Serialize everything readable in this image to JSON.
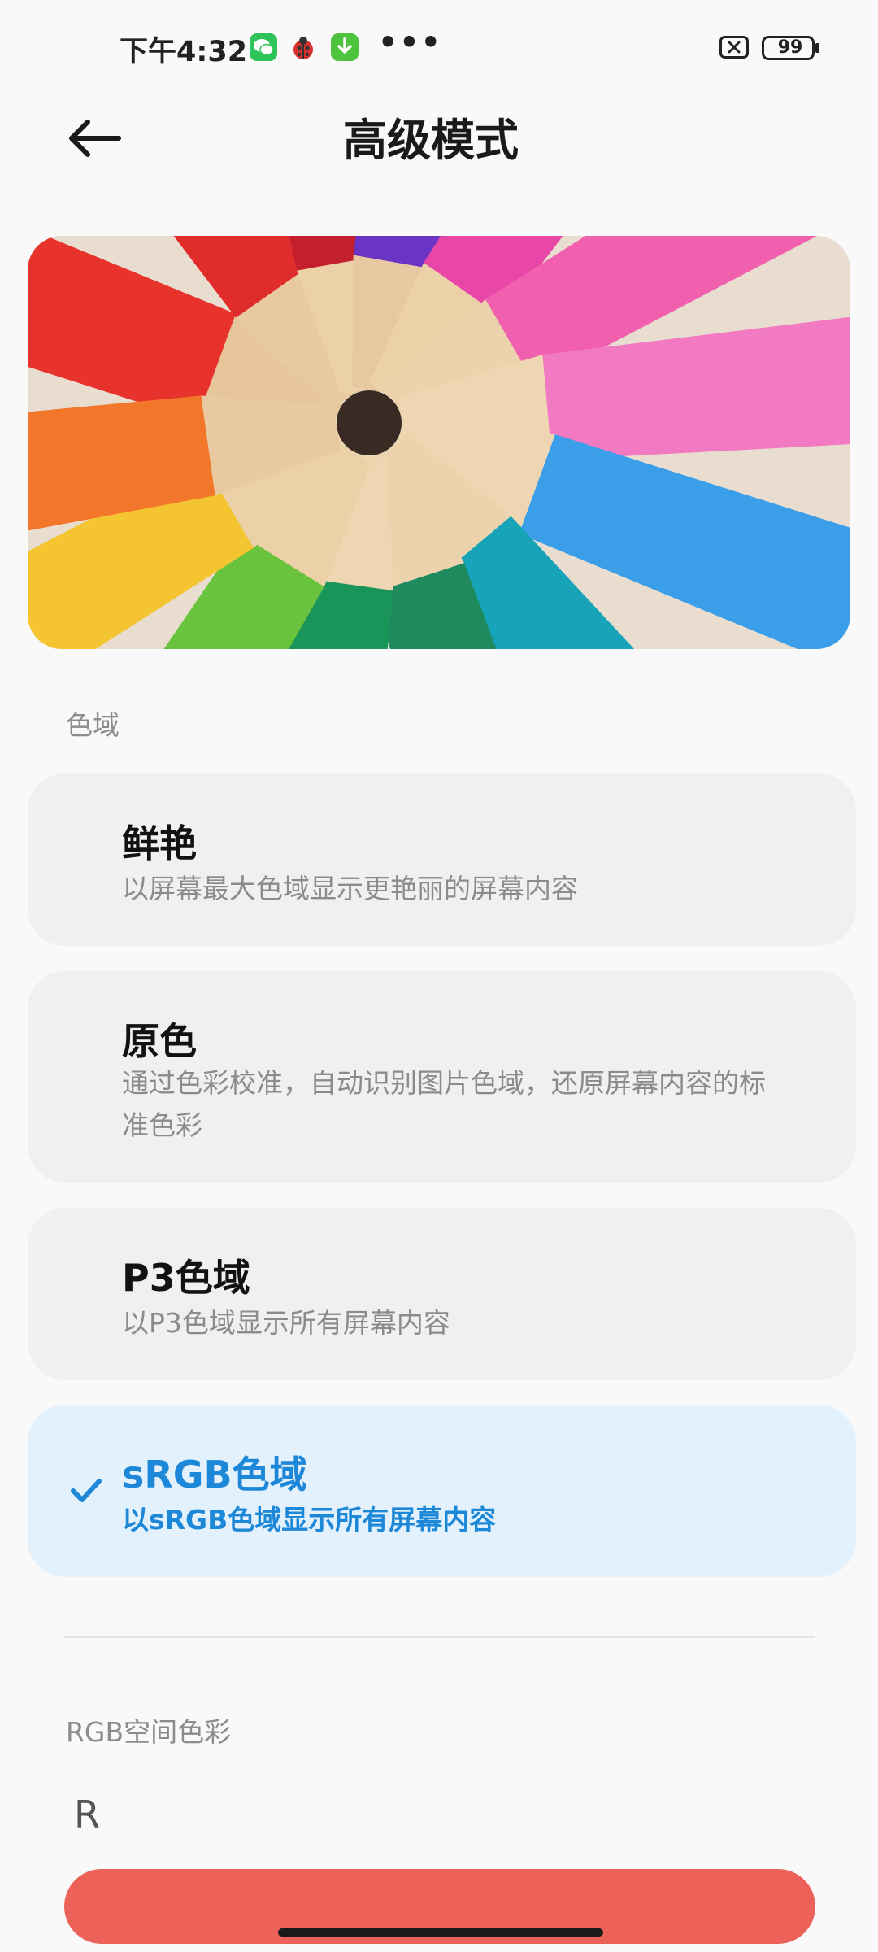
{
  "status_bar": {
    "time": "下午4:32",
    "more": "•••",
    "battery": "99",
    "app_icons": [
      "wechat-icon",
      "ladybug-icon",
      "download-icon"
    ]
  },
  "header": {
    "title": "高级模式",
    "back_icon": "arrow-left-icon"
  },
  "gamut": {
    "label": "色域",
    "selected": "sRGB色域",
    "options": [
      {
        "title": "鲜艳",
        "desc": "以屏幕最大色域显示更艳丽的屏幕内容",
        "selected": false
      },
      {
        "title": "原色",
        "desc": "通过色彩校准，自动识别图片色域，还原屏幕内容的标准色彩",
        "selected": false
      },
      {
        "title": "P3色域",
        "desc": "以P3色域显示所有屏幕内容",
        "selected": false
      },
      {
        "title": "sRGB色域",
        "desc": "以sRGB色域显示所有屏幕内容",
        "selected": true
      }
    ]
  },
  "rgb": {
    "label": "RGB空间色彩",
    "channel_r": "R"
  },
  "colors": {
    "accent": "#1e88d8",
    "selected_bg": "#e3f1fd",
    "card_bg": "#f0f0f0",
    "slider_r": "#ec6158"
  }
}
